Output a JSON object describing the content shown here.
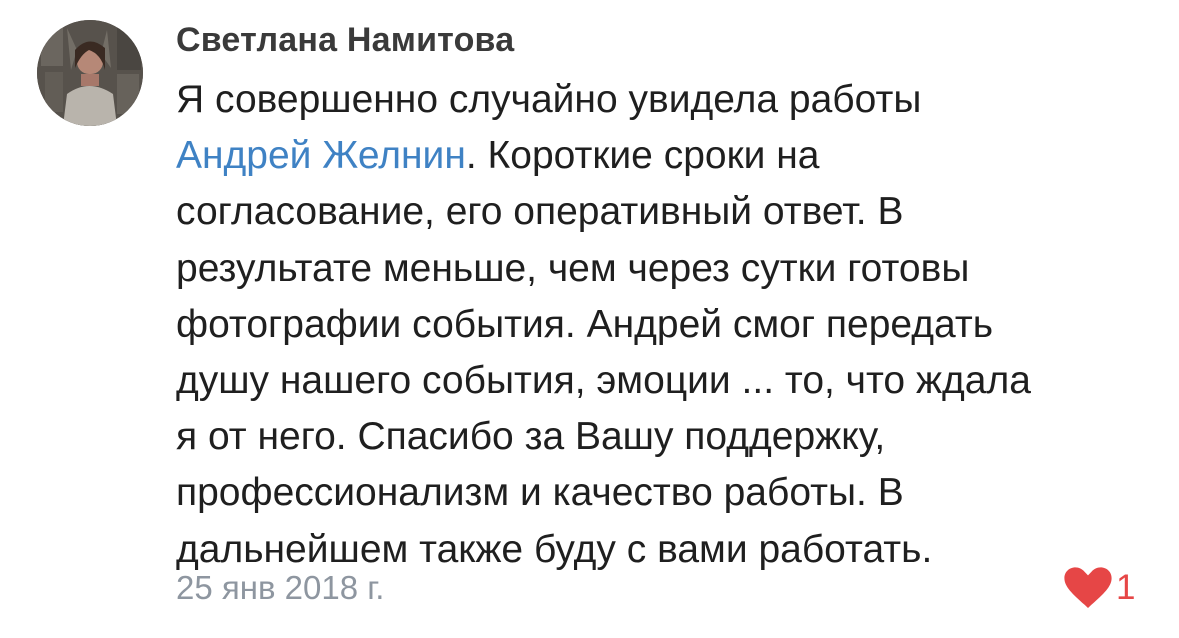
{
  "comment": {
    "author": "Светлана Намитова",
    "lines": [
      {
        "before": "Я совершенно случайно увидела работы",
        "mention": "",
        "after": ""
      },
      {
        "before": "",
        "mention": "Андрей Желнин",
        "after": ". Короткие сроки на"
      },
      {
        "before": "согласование, его оперативный ответ. В",
        "mention": "",
        "after": ""
      },
      {
        "before": "результате меньше, чем через сутки готовы",
        "mention": "",
        "after": ""
      },
      {
        "before": "фотографии события. Андрей смог передать",
        "mention": "",
        "after": ""
      },
      {
        "before": "душу нашего события, эмоции ... то, что ждала",
        "mention": "",
        "after": ""
      },
      {
        "before": "я от него. Спасибо за Вашу поддержку,",
        "mention": "",
        "after": ""
      },
      {
        "before": "профессионализм и качество работы. В",
        "mention": "",
        "after": ""
      },
      {
        "before": "дальнейшем также буду с вами работать.",
        "mention": "",
        "after": ""
      }
    ],
    "date": "25 янв 2018 г.",
    "likes": "1",
    "like_icon": "heart-icon",
    "colors": {
      "mention": "#3f82c4",
      "like": "#e64646",
      "meta": "#8e96a0"
    }
  }
}
